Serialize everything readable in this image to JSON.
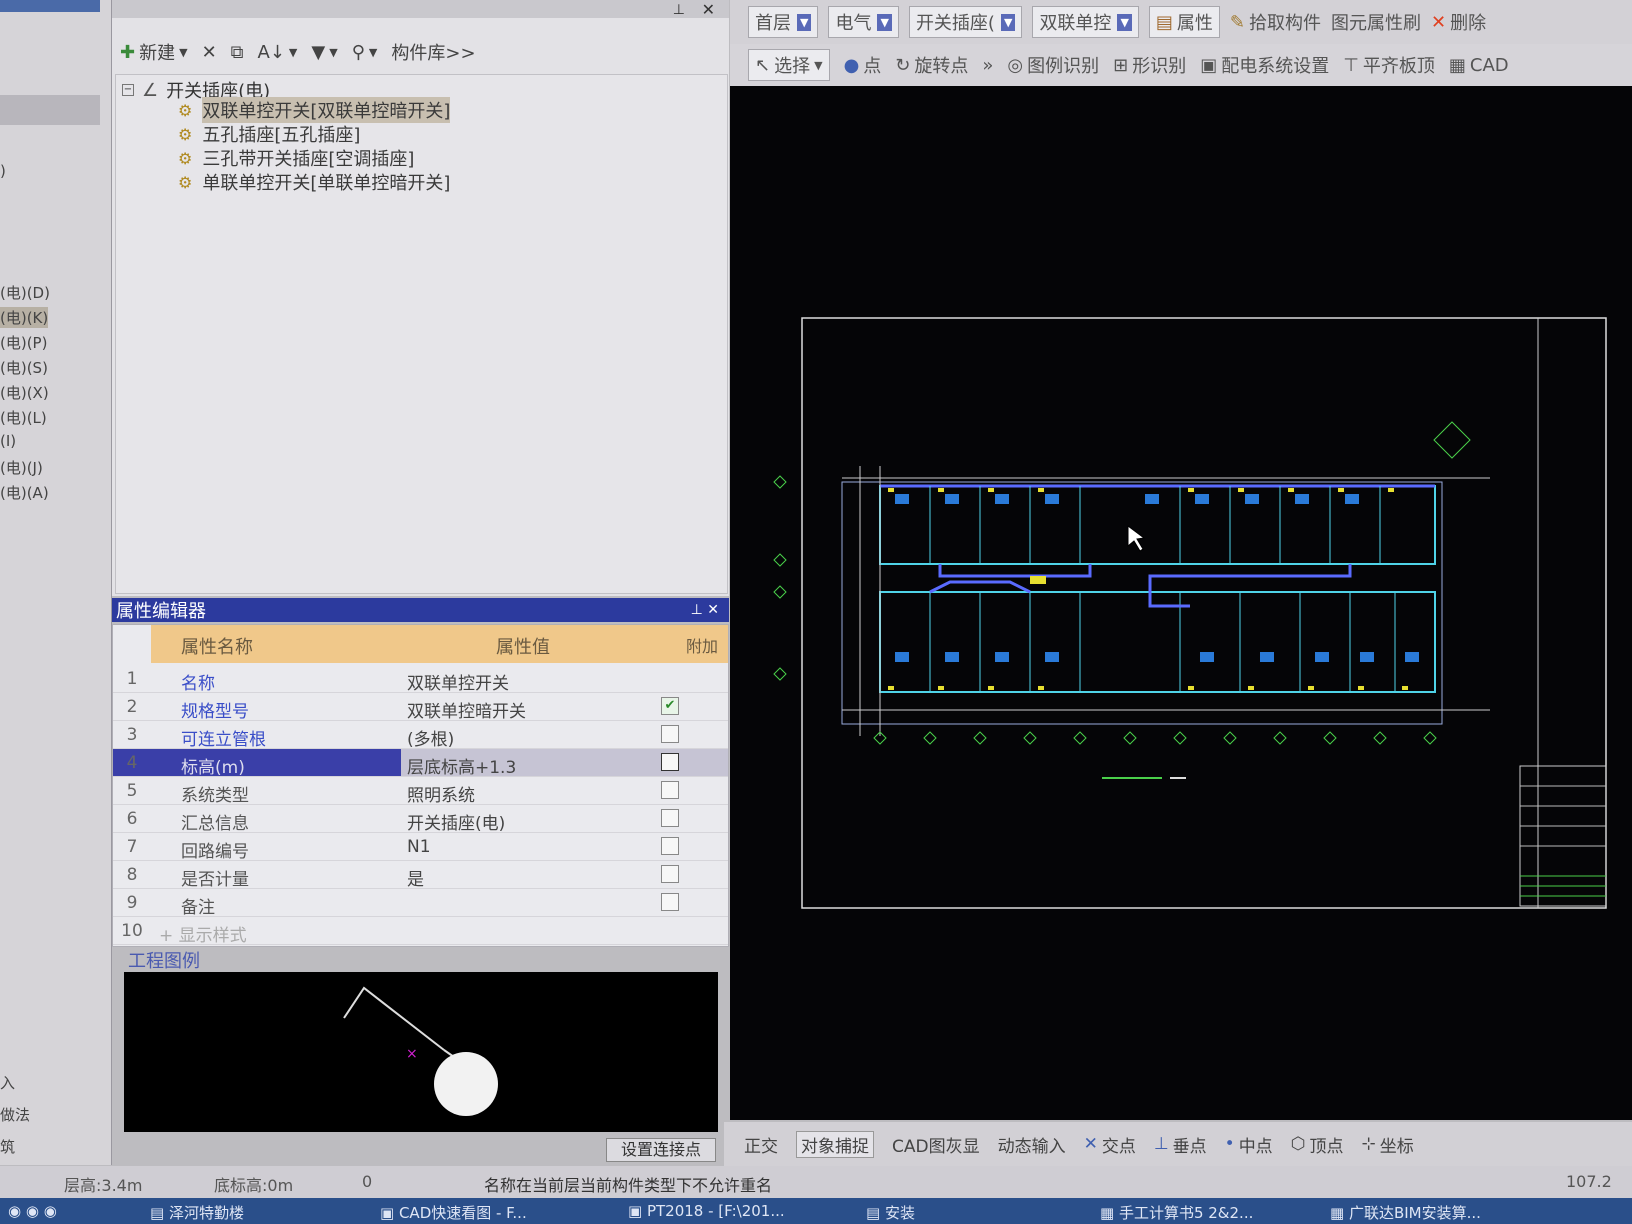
{
  "left_list": {
    "items": [
      "(电)(D)",
      "(电)(K)",
      "(电)(P)",
      "(电)(S)",
      "(电)(X)",
      "(电)(L)",
      "(I)",
      "(电)(J)",
      "(电)(A)"
    ],
    "bottom_items": [
      "入",
      "做法",
      "筑"
    ]
  },
  "tree_toolbar": {
    "new_label": "新建",
    "library_label": "构件库>>"
  },
  "tree": {
    "root_label": "开关插座(电)",
    "items": [
      "双联单控开关[双联单控暗开关]",
      "五孔插座[五孔插座]",
      "三孔带开关插座[空调插座]",
      "单联单控开关[单联单控暗开关]"
    ]
  },
  "prop_editor": {
    "title": "属性编辑器",
    "col_name": "属性名称",
    "col_value": "属性值",
    "col_extra": "附加",
    "rows": [
      {
        "n": "1",
        "name": "名称",
        "value": "双联单控开关"
      },
      {
        "n": "2",
        "name": "规格型号",
        "value": "双联单控暗开关"
      },
      {
        "n": "3",
        "name": "可连立管根",
        "value": "(多根)"
      },
      {
        "n": "4",
        "name": "标高(m)",
        "value": "层底标高+1.3"
      },
      {
        "n": "5",
        "name": "系统类型",
        "value": "照明系统"
      },
      {
        "n": "6",
        "name": "汇总信息",
        "value": "开关插座(电)"
      },
      {
        "n": "7",
        "name": "回路编号",
        "value": "N1"
      },
      {
        "n": "8",
        "name": "是否计量",
        "value": "是"
      },
      {
        "n": "9",
        "name": "备注",
        "value": ""
      },
      {
        "n": "10",
        "name": "+ 显示样式",
        "value": ""
      }
    ]
  },
  "legend": {
    "label": "工程图例",
    "set_point_label": "设置连接点"
  },
  "toolbar_top": {
    "floor": "首层",
    "discipline": "电气",
    "category": "开关插座(",
    "component": "双联单控",
    "properties": "属性",
    "pick": "拾取构件",
    "brush": "图元属性刷",
    "delete": "删除"
  },
  "toolbar_second": {
    "select": "选择",
    "point": "点",
    "rotate_point": "旋转点",
    "legend_recognize": "图例识别",
    "shape_recognize": "形识别",
    "distribution": "配电系统设置",
    "align_top": "平齐板顶",
    "cad": "CAD"
  },
  "snap_bar": {
    "ortho": "正交",
    "snap": "对象捕捉",
    "cad_gray": "CAD图灰显",
    "dyn_input": "动态输入",
    "intersection": "交点",
    "perpendicular": "垂点",
    "midpoint": "中点",
    "vertex": "顶点",
    "coordinate": "坐标"
  },
  "status_bar": {
    "floor_height": "层高:3.4m",
    "bottom_elev": "底标高:0m",
    "zero": "0",
    "message": "名称在当前层当前构件类型下不允许重名",
    "coord": "107.2"
  },
  "taskbar": {
    "items": [
      "泽河特勤楼",
      "CAD快速看图 - F...",
      "PT2018 - [F:\\201...",
      "安装",
      "手工计算书5 2&2...",
      "广联达BIM安装算..."
    ]
  },
  "colors": {
    "title_blue": "#2c3a9e",
    "header_orange": "#f0c88a",
    "cad_bg": "#050507",
    "wall_cyan": "#4fd3e8",
    "pipe_blue": "#5a6bff"
  }
}
